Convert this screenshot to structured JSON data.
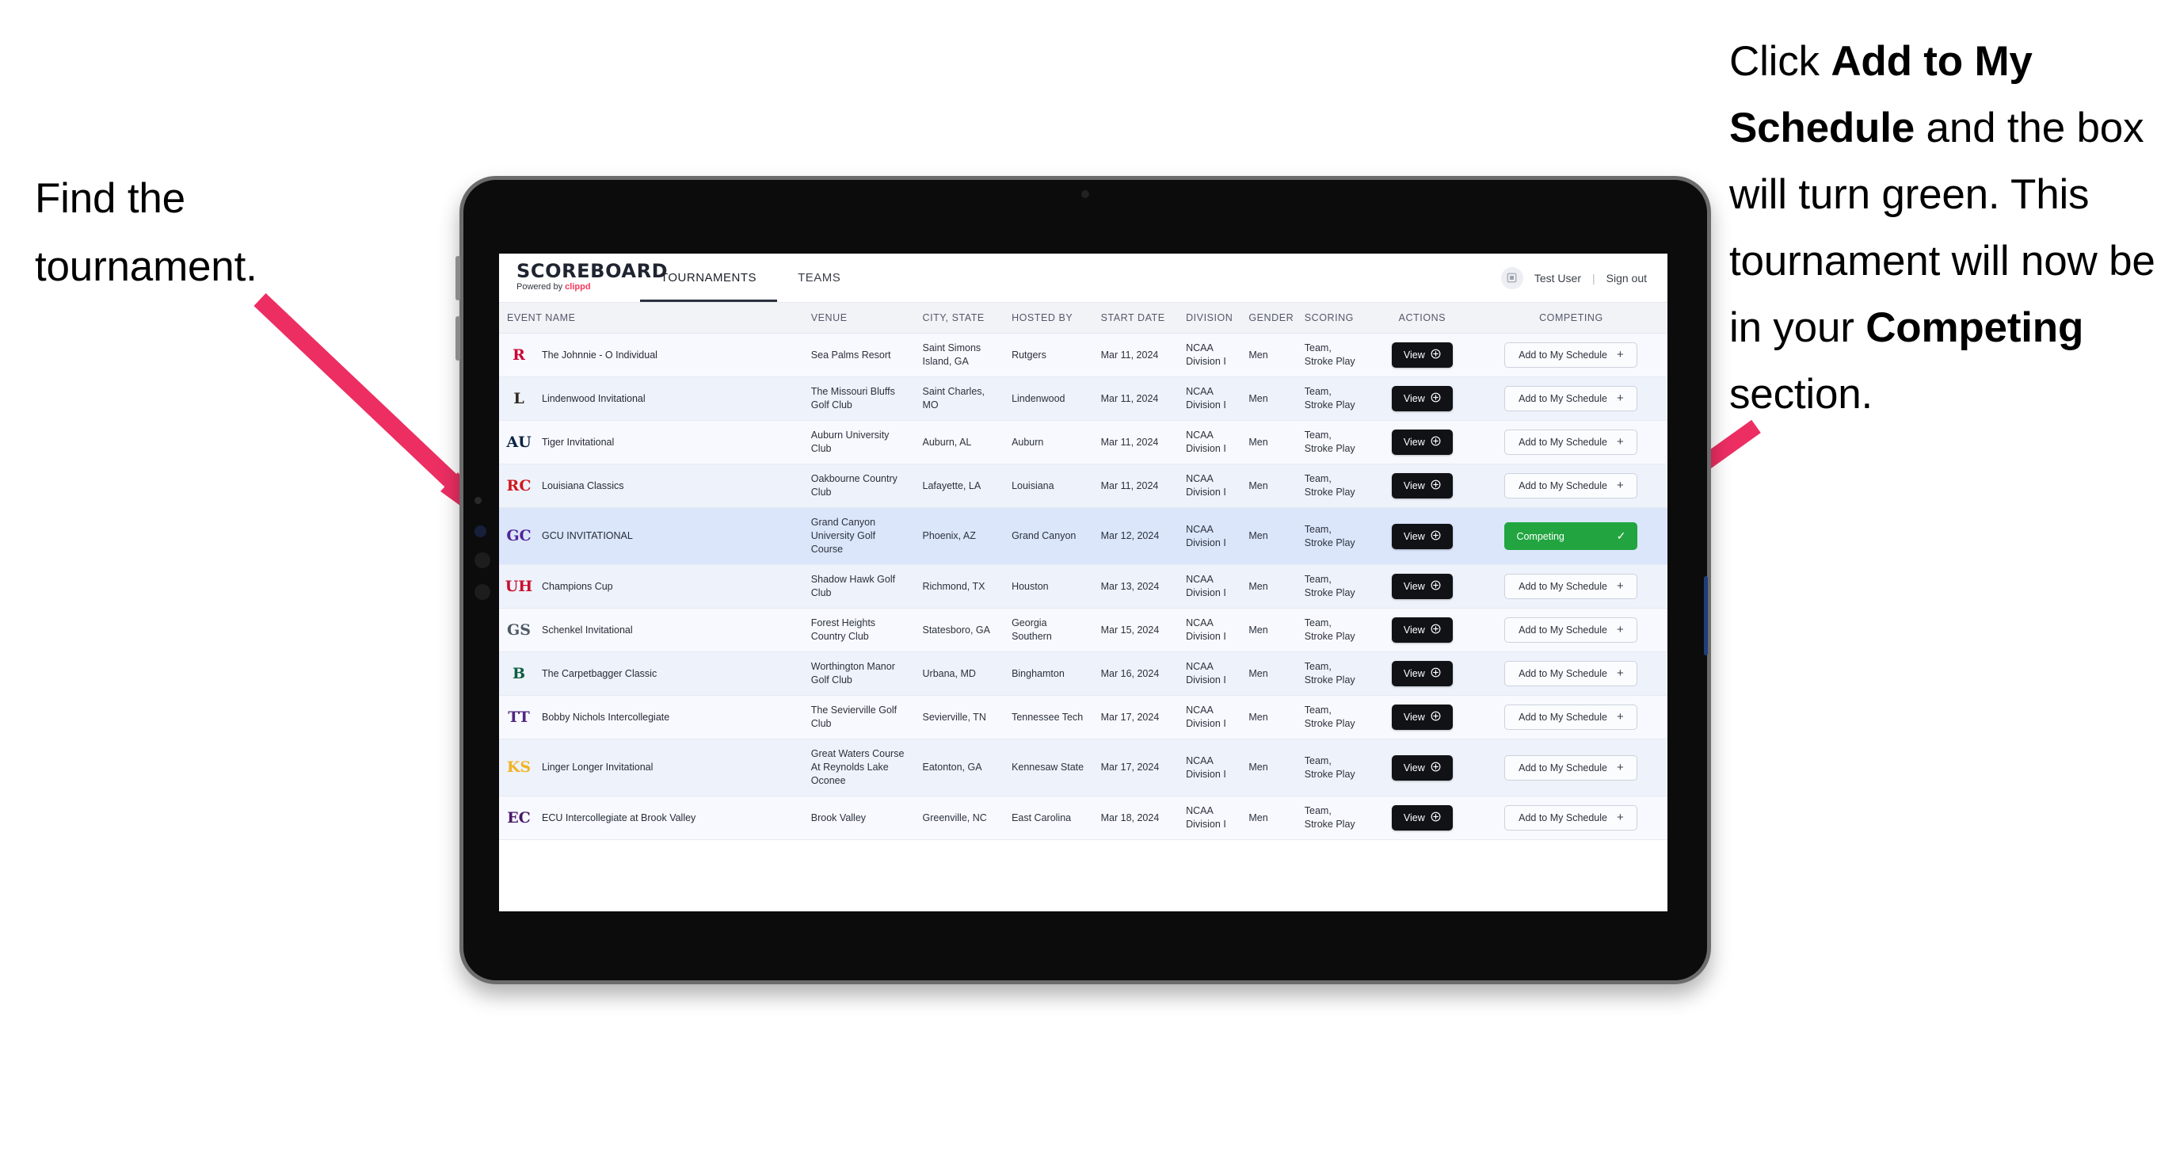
{
  "annotations": {
    "left": "Find the tournament.",
    "right_parts": [
      {
        "t": "Click ",
        "b": false
      },
      {
        "t": "Add to My Schedule",
        "b": true
      },
      {
        "t": " and the box will turn green. This tournament will now be in your ",
        "b": false
      },
      {
        "t": "Competing",
        "b": true
      },
      {
        "t": " section.",
        "b": false
      }
    ],
    "arrow_color": "#ec2e63"
  },
  "app": {
    "brand": {
      "name": "SCOREBOARD",
      "powered_prefix": "Powered by ",
      "powered_brand": "clippd"
    },
    "tabs": [
      {
        "label": "TOURNAMENTS",
        "active": true
      },
      {
        "label": "TEAMS",
        "active": false
      }
    ],
    "user": {
      "avatar_icon": "user-badge-icon",
      "name": "Test User",
      "separator": "|",
      "signout": "Sign out"
    },
    "table": {
      "columns": [
        "EVENT NAME",
        "VENUE",
        "CITY, STATE",
        "HOSTED BY",
        "START DATE",
        "DIVISION",
        "GENDER",
        "SCORING",
        "ACTIONS",
        "COMPETING"
      ],
      "view_label": "View",
      "add_label": "Add to My Schedule",
      "add_icon": "plus-icon",
      "competing_label": "Competing",
      "competing_icon": "check-icon",
      "view_icon": "circle-plus-icon",
      "competing_color": "#22a540",
      "selected_row_color": "#dbe6fb",
      "rows": [
        {
          "logo_text": "R",
          "logo_color": "#cc0033",
          "logo_name": "rutgers-logo-icon",
          "event": "The Johnnie - O Individual",
          "venue": "Sea Palms Resort",
          "city": "Saint Simons Island, GA",
          "host": "Rutgers",
          "date": "Mar 11, 2024",
          "division": "NCAA Division I",
          "gender": "Men",
          "scoring": "Team, Stroke Play",
          "competing": false
        },
        {
          "logo_text": "L",
          "logo_color": "#2f2a22",
          "logo_name": "lindenwood-lion-logo-icon",
          "event": "Lindenwood Invitational",
          "venue": "The Missouri Bluffs Golf Club",
          "city": "Saint Charles, MO",
          "host": "Lindenwood",
          "date": "Mar 11, 2024",
          "division": "NCAA Division I",
          "gender": "Men",
          "scoring": "Team, Stroke Play",
          "competing": false
        },
        {
          "logo_text": "AU",
          "logo_color": "#0c2340",
          "logo_name": "auburn-logo-icon",
          "event": "Tiger Invitational",
          "venue": "Auburn University Club",
          "city": "Auburn, AL",
          "host": "Auburn",
          "date": "Mar 11, 2024",
          "division": "NCAA Division I",
          "gender": "Men",
          "scoring": "Team, Stroke Play",
          "competing": false
        },
        {
          "logo_text": "RC",
          "logo_color": "#ce181e",
          "logo_name": "louisiana-ragin-cajuns-logo-icon",
          "event": "Louisiana Classics",
          "venue": "Oakbourne Country Club",
          "city": "Lafayette, LA",
          "host": "Louisiana",
          "date": "Mar 11, 2024",
          "division": "NCAA Division I",
          "gender": "Men",
          "scoring": "Team, Stroke Play",
          "competing": false
        },
        {
          "logo_text": "GC",
          "logo_color": "#522398",
          "logo_name": "grand-canyon-lopes-logo-icon",
          "event": "GCU INVITATIONAL",
          "venue": "Grand Canyon University Golf Course",
          "city": "Phoenix, AZ",
          "host": "Grand Canyon",
          "date": "Mar 12, 2024",
          "division": "NCAA Division I",
          "gender": "Men",
          "scoring": "Team, Stroke Play",
          "competing": true
        },
        {
          "logo_text": "UH",
          "logo_color": "#c8102e",
          "logo_name": "houston-logo-icon",
          "event": "Champions Cup",
          "venue": "Shadow Hawk Golf Club",
          "city": "Richmond, TX",
          "host": "Houston",
          "date": "Mar 13, 2024",
          "division": "NCAA Division I",
          "gender": "Men",
          "scoring": "Team, Stroke Play",
          "competing": false
        },
        {
          "logo_text": "GS",
          "logo_color": "#4e5a66",
          "logo_name": "georgia-southern-eagles-logo-icon",
          "event": "Schenkel Invitational",
          "venue": "Forest Heights Country Club",
          "city": "Statesboro, GA",
          "host": "Georgia Southern",
          "date": "Mar 15, 2024",
          "division": "NCAA Division I",
          "gender": "Men",
          "scoring": "Team, Stroke Play",
          "competing": false
        },
        {
          "logo_text": "B",
          "logo_color": "#0d5e3f",
          "logo_name": "binghamton-bearcats-logo-icon",
          "event": "The Carpetbagger Classic",
          "venue": "Worthington Manor Golf Club",
          "city": "Urbana, MD",
          "host": "Binghamton",
          "date": "Mar 16, 2024",
          "division": "NCAA Division I",
          "gender": "Men",
          "scoring": "Team, Stroke Play",
          "competing": false
        },
        {
          "logo_text": "TT",
          "logo_color": "#52247f",
          "logo_name": "tennessee-tech-eagle-logo-icon",
          "event": "Bobby Nichols Intercollegiate",
          "venue": "The Sevierville Golf Club",
          "city": "Sevierville, TN",
          "host": "Tennessee Tech",
          "date": "Mar 17, 2024",
          "division": "NCAA Division I",
          "gender": "Men",
          "scoring": "Team, Stroke Play",
          "competing": false
        },
        {
          "logo_text": "KS",
          "logo_color": "#f0b323",
          "logo_name": "kennesaw-state-owls-logo-icon",
          "event": "Linger Longer Invitational",
          "venue": "Great Waters Course At Reynolds Lake Oconee",
          "city": "Eatonton, GA",
          "host": "Kennesaw State",
          "date": "Mar 17, 2024",
          "division": "NCAA Division I",
          "gender": "Men",
          "scoring": "Team, Stroke Play",
          "competing": false
        },
        {
          "logo_text": "EC",
          "logo_color": "#4b1869",
          "logo_name": "east-carolina-pirates-logo-icon",
          "event": "ECU Intercollegiate at Brook Valley",
          "venue": "Brook Valley",
          "city": "Greenville, NC",
          "host": "East Carolina",
          "date": "Mar 18, 2024",
          "division": "NCAA Division I",
          "gender": "Men",
          "scoring": "Team, Stroke Play",
          "competing": false
        }
      ]
    }
  }
}
